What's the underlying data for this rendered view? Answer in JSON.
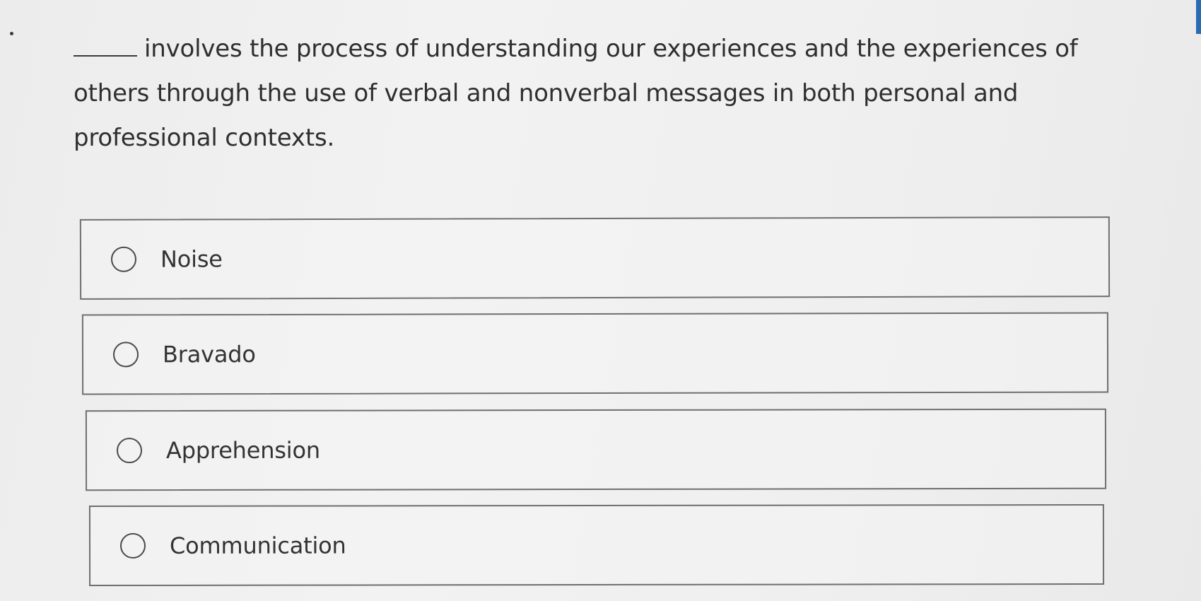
{
  "question": {
    "blank": "_____",
    "text": "involves the process of understanding our experiences and the experiences of others through the use of verbal and nonverbal messages in both personal and professional contexts."
  },
  "options": [
    {
      "label": "Noise",
      "selected": false
    },
    {
      "label": "Bravado",
      "selected": false
    },
    {
      "label": "Apprehension",
      "selected": false
    },
    {
      "label": "Communication",
      "selected": false
    }
  ],
  "colors": {
    "background": "#efefef",
    "border": "#6f6f6f",
    "text": "#2f2f2f",
    "scroll_accent": "#2b6cb0"
  }
}
